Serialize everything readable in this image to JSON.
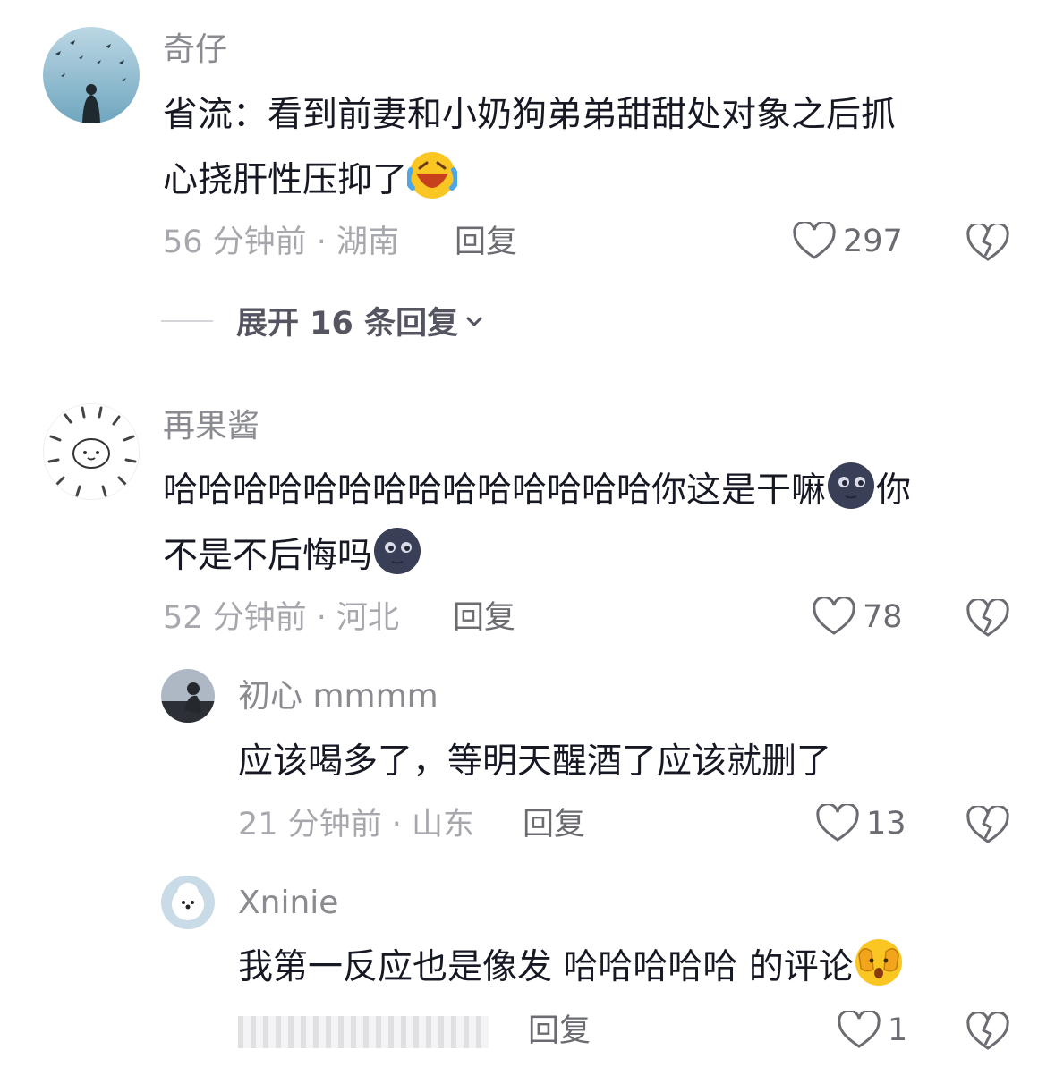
{
  "comments": [
    {
      "username": "奇仔",
      "line1": "省流：看到前妻和小奶狗弟弟甜甜处对象之后抓",
      "line2": "心挠肝性压抑了",
      "line2_emoji": "laugh-cry-emoji",
      "meta": "56 分钟前 · 湖南",
      "reply_label": "回复",
      "likes": "297",
      "expand_label": "展开 16 条回复"
    },
    {
      "username": "再果酱",
      "line1": "哈哈哈哈哈哈哈哈哈哈哈哈哈哈你这是干嘛",
      "line1_tail": "你",
      "line2": "不是不后悔吗",
      "emoji": "moon-face-emoji",
      "meta": "52 分钟前 · 河北",
      "reply_label": "回复",
      "likes": "78",
      "replies": [
        {
          "username": "初心 mmmm",
          "text": "应该喝多了，等明天醒酒了应该就删了",
          "meta": "21 分钟前 · 山东",
          "reply_label": "回复",
          "likes": "13"
        },
        {
          "username": "Xninie",
          "text": "我第一反应也是像发 哈哈哈哈哈 的评论",
          "emoji": "peeking-face-emoji",
          "reply_label": "回复",
          "likes": "1"
        }
      ]
    }
  ],
  "icons": {
    "like": "heart-outline-icon",
    "dislike": "broken-heart-icon",
    "expand": "chevron-down-icon"
  },
  "colors": {
    "text": "#161823",
    "secondary": "#8a8b91",
    "meta": "#a7a8ad"
  }
}
